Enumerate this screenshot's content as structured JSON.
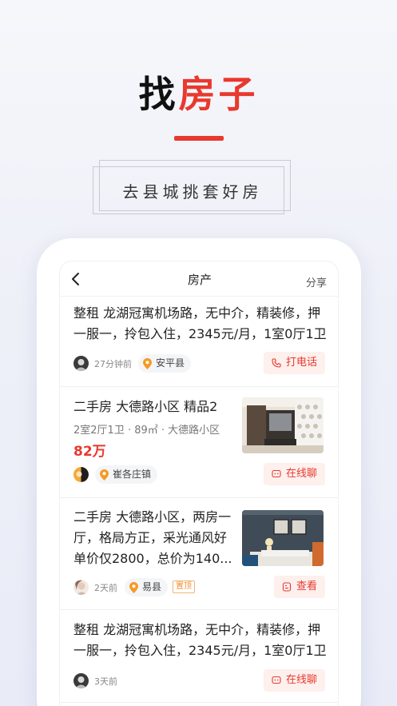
{
  "hero": {
    "title_part1": "找",
    "title_part2": "房子",
    "subtitle": "去县城挑套好房"
  },
  "navbar": {
    "back_icon": "chevron-left-icon",
    "title": "房产",
    "share_label": "分享"
  },
  "listings": [
    {
      "title": "整租 龙湖冠寓机场路，无中介，精装修，押一服一，拎包入住，2345元/月，1室0厅1卫",
      "time": "27分钟前",
      "location": "安平县",
      "action_label": "打电话",
      "action_icon": "phone-icon"
    },
    {
      "title": "二手房 大德路小区 精品2",
      "meta": "2室2厅1卫 · 89㎡ · 大德路小区",
      "price": "82万",
      "location": "崔各庄镇",
      "action_label": "在线聊",
      "action_icon": "chat-icon"
    },
    {
      "title": "二手房 大德路小区，两房一厅，格局方正，采光通风好单价仅2800，总价为140...",
      "time": "2天前",
      "location": "易县",
      "badge": "置顶",
      "action_label": "查看",
      "action_icon": "document-icon"
    },
    {
      "title": "整租 龙湖冠寓机场路，无中介，精装修，押一服一，拎包入住，2345元/月，1室0厅1卫",
      "time": "3天前",
      "action_label": "在线聊",
      "action_icon": "chat-icon"
    }
  ],
  "colors": {
    "accent": "#e8392e",
    "action_bg": "#fdf0ed",
    "badge": "#f09030"
  }
}
